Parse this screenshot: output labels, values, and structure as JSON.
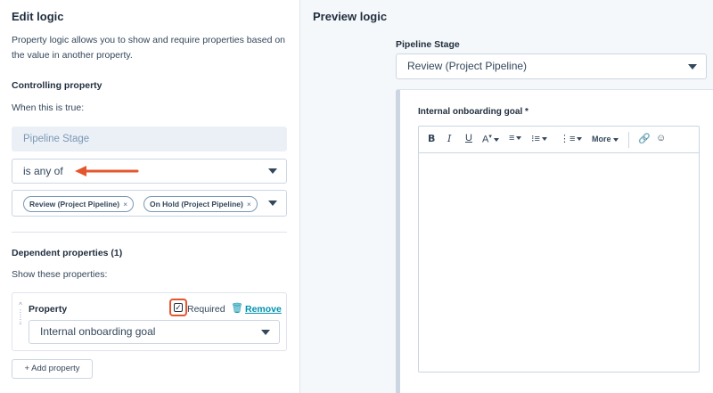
{
  "left": {
    "title": "Edit logic",
    "description_line1": "Property logic allows you to show and require properties based on",
    "description_line2": "the value in another property.",
    "controlling_title": "Controlling property",
    "when_text": "When this is true:",
    "controlling_property_value": "Pipeline Stage",
    "operator_value": "is any of",
    "chips": [
      {
        "label": "Review (Project Pipeline)"
      },
      {
        "label": "On Hold (Project Pipeline)"
      }
    ],
    "dependent_title": "Dependent properties (1)",
    "show_text": "Show these properties:",
    "property_label": "Property",
    "required_label": "Required",
    "required_checked": true,
    "remove_label": "Remove",
    "dependent_property_value": "Internal onboarding goal",
    "add_button_label": "+ Add property"
  },
  "right": {
    "title": "Preview logic",
    "pipeline_label": "Pipeline Stage",
    "pipeline_value": "Review (Project Pipeline)",
    "field_label": "Internal onboarding goal *",
    "toolbar": {
      "bold": "B",
      "italic": "I",
      "underline": "U",
      "more": "More"
    }
  },
  "colors": {
    "accent": "#0091ae",
    "highlight": "#e4572e",
    "panel_bg": "#f5f8fa"
  }
}
